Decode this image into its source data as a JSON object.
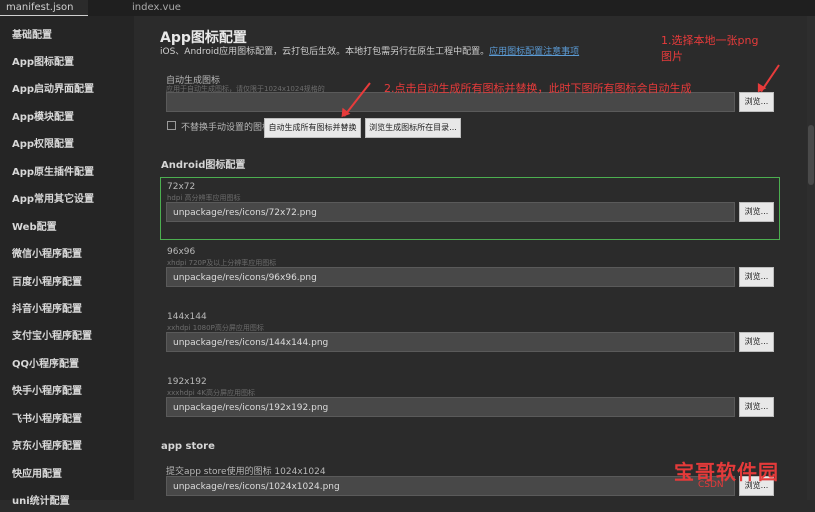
{
  "tabs": [
    "manifest.json",
    "index.vue"
  ],
  "sidebar": {
    "items": [
      "基础配置",
      "App图标配置",
      "App启动界面配置",
      "App模块配置",
      "App权限配置",
      "App原生插件配置",
      "App常用其它设置",
      "Web配置",
      "微信小程序配置",
      "百度小程序配置",
      "抖音小程序配置",
      "支付宝小程序配置",
      "QQ小程序配置",
      "快手小程序配置",
      "飞书小程序配置",
      "京东小程序配置",
      "快应用配置",
      "uni统计配置"
    ]
  },
  "main": {
    "title": "App图标配置",
    "description": "iOS、Android应用图标配置，云打包后生效。本地打包需另行在原生工程中配置。",
    "link": "应用图标配置注意事项",
    "auto": {
      "label": "自动生成图标",
      "hint": "应用于自动生成图标，请仅限于1024x1024规格的",
      "value": "",
      "browse": "浏览...",
      "checkbox_label": "不替换手动设置的图标",
      "gen_button": "自动生成所有图标并替换",
      "open_dir_button": "浏览生成图标所在目录..."
    },
    "android_section": "Android图标配置",
    "icons": [
      {
        "size": "72x72",
        "hint": "hdpi 高分辨率应用图标",
        "path": "unpackage/res/icons/72x72.png",
        "browse": "浏览..."
      },
      {
        "size": "96x96",
        "hint": "xhdpi 720P及以上分辨率应用图标",
        "path": "unpackage/res/icons/96x96.png",
        "browse": "浏览..."
      },
      {
        "size": "144x144",
        "hint": "xxhdpi 1080P高分屏应用图标",
        "path": "unpackage/res/icons/144x144.png",
        "browse": "浏览..."
      },
      {
        "size": "192x192",
        "hint": "xxxhdpi 4K高分屏应用图标",
        "path": "unpackage/res/icons/192x192.png",
        "browse": "浏览..."
      }
    ],
    "appstore_section": "app store",
    "appstore": {
      "label": "提交app store使用的图标 1024x1024",
      "path": "unpackage/res/icons/1024x1024.png",
      "browse": "浏览..."
    }
  },
  "annotations": {
    "a1_line1": "1.选择本地一张png",
    "a1_line2": "图片",
    "a2": "2.点击自动生成所有图标并替换，此时下图所有图标会自动生成"
  },
  "watermark": {
    "text": "宝哥软件园",
    "sub": "CSDN"
  }
}
